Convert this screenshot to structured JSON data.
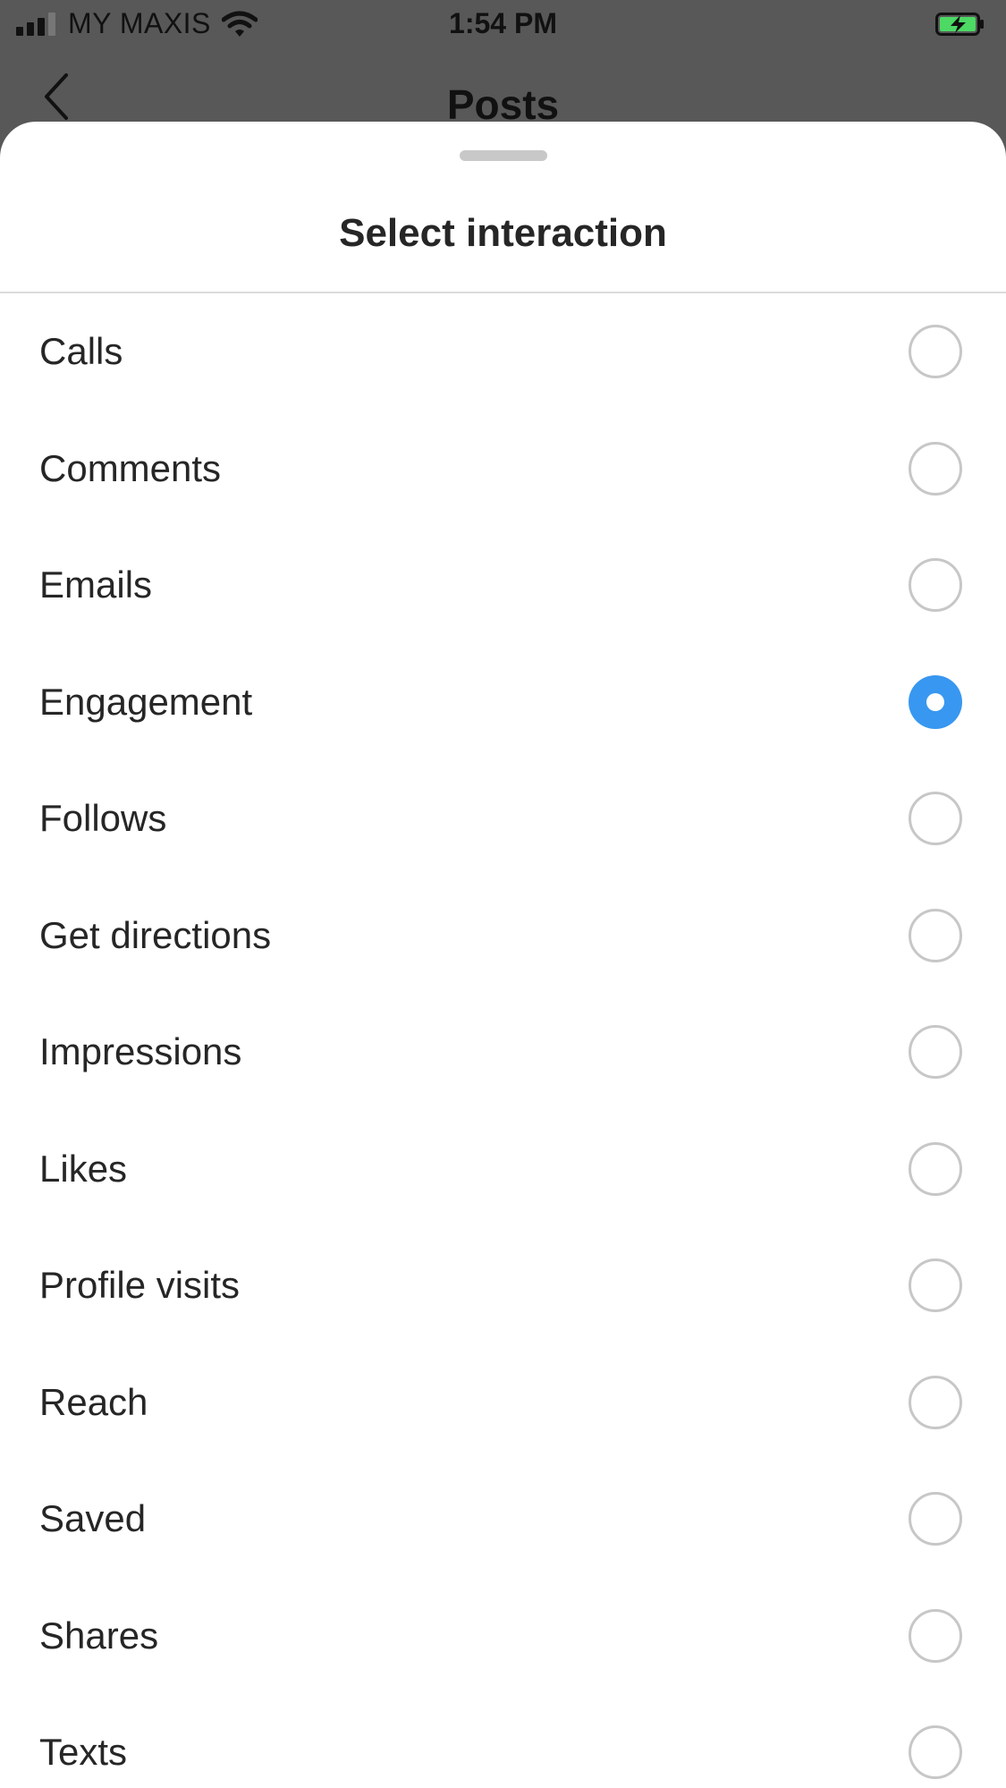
{
  "status_bar": {
    "carrier": "MY MAXIS",
    "time": "1:54 PM",
    "icons": [
      "signal-icon",
      "wifi-icon",
      "battery-charging-icon"
    ],
    "battery_color": "#4cd964"
  },
  "nav": {
    "back_icon": "chevron-left-icon",
    "title": "Posts"
  },
  "sheet": {
    "title": "Select interaction",
    "selected_index": 3,
    "accent_color": "#3897f0",
    "options": [
      {
        "label": "Calls",
        "selected": false
      },
      {
        "label": "Comments",
        "selected": false
      },
      {
        "label": "Emails",
        "selected": false
      },
      {
        "label": "Engagement",
        "selected": true
      },
      {
        "label": "Follows",
        "selected": false
      },
      {
        "label": "Get directions",
        "selected": false
      },
      {
        "label": "Impressions",
        "selected": false
      },
      {
        "label": "Likes",
        "selected": false
      },
      {
        "label": "Profile visits",
        "selected": false
      },
      {
        "label": "Reach",
        "selected": false
      },
      {
        "label": "Saved",
        "selected": false
      },
      {
        "label": "Shares",
        "selected": false
      },
      {
        "label": "Texts",
        "selected": false
      }
    ]
  }
}
